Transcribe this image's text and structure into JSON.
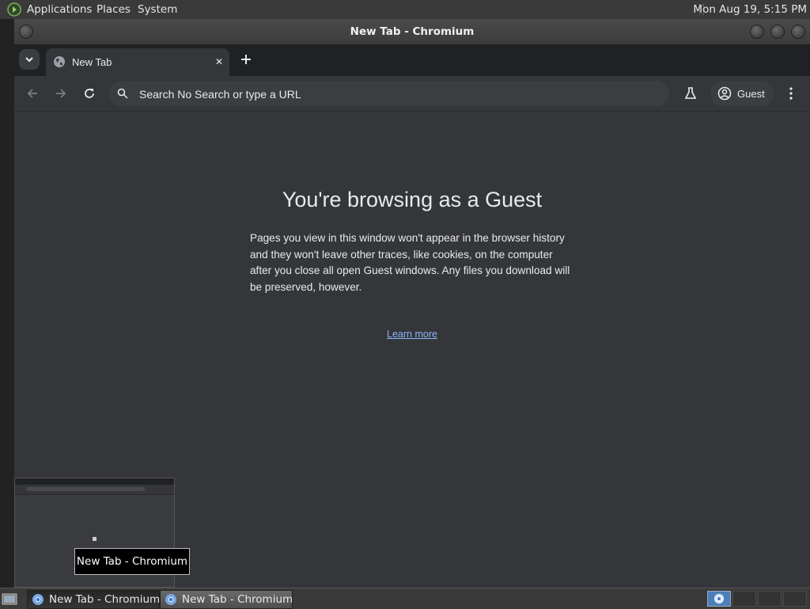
{
  "top_panel": {
    "menus": [
      "Applications",
      "Places",
      "System"
    ],
    "clock": "Mon Aug 19,  5:15 PM"
  },
  "window": {
    "title": "New Tab - Chromium"
  },
  "tab": {
    "title": "New Tab",
    "close": "✕"
  },
  "toolbar": {
    "omnibox_placeholder": "Search No Search or type a URL",
    "profile_label": "Guest"
  },
  "content": {
    "title": "You're browsing as a Guest",
    "description": "Pages you view in this window won't appear in the browser history and they won't leave other traces, like cookies, on the computer after you close all open Guest windows. Any files you download will be preserved, however.",
    "learn_more": "Learn more"
  },
  "tooltip": "New Tab - Chromium",
  "taskbar": {
    "tasks": [
      {
        "label": "New Tab - Chromium"
      },
      {
        "label": "New Tab - Chromium"
      }
    ]
  },
  "colors": {
    "background": "#35363a",
    "tabstrip": "#202124",
    "link": "#8ab4f8",
    "text": "#e8eaed"
  },
  "icons": [
    "mate-logo-icon",
    "tab-search-icon",
    "globe-icon",
    "close-icon",
    "plus-icon",
    "back-icon",
    "forward-icon",
    "reload-icon",
    "search-icon",
    "labs-icon",
    "profile-icon",
    "menu-icon",
    "chromium-icon",
    "show-desktop-icon"
  ]
}
